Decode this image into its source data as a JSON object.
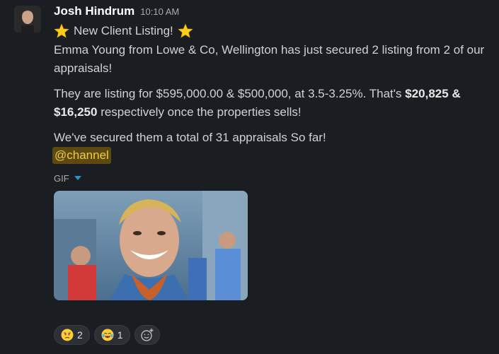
{
  "message": {
    "author": "Josh Hindrum",
    "time": "10:10 AM",
    "title": "New Client Listing!",
    "line1": "Emma Young from Lowe & Co, Wellington has just secured 2 listing from 2 of our appraisals!",
    "line2_prefix": "They are listing for $595,000.00 & $500,000, at 3.5-3.25%. That's",
    "line2_bold": "$20,825 & $16,250",
    "line2_suffix": "respectively once the properties sells!",
    "line3": "We've secured them a total of 31 appraisals So far!",
    "mention": "@channel",
    "gif_label": "GIF"
  },
  "reactions": [
    {
      "emoji": "disappointed-relieved-face",
      "count": "2"
    },
    {
      "emoji": "tears-of-joy-face",
      "count": "1"
    }
  ],
  "colors": {
    "background": "#1a1d21",
    "mention_bg": "#5c4a10",
    "mention_text": "#f2c94c",
    "link": "#1d9bd1"
  }
}
